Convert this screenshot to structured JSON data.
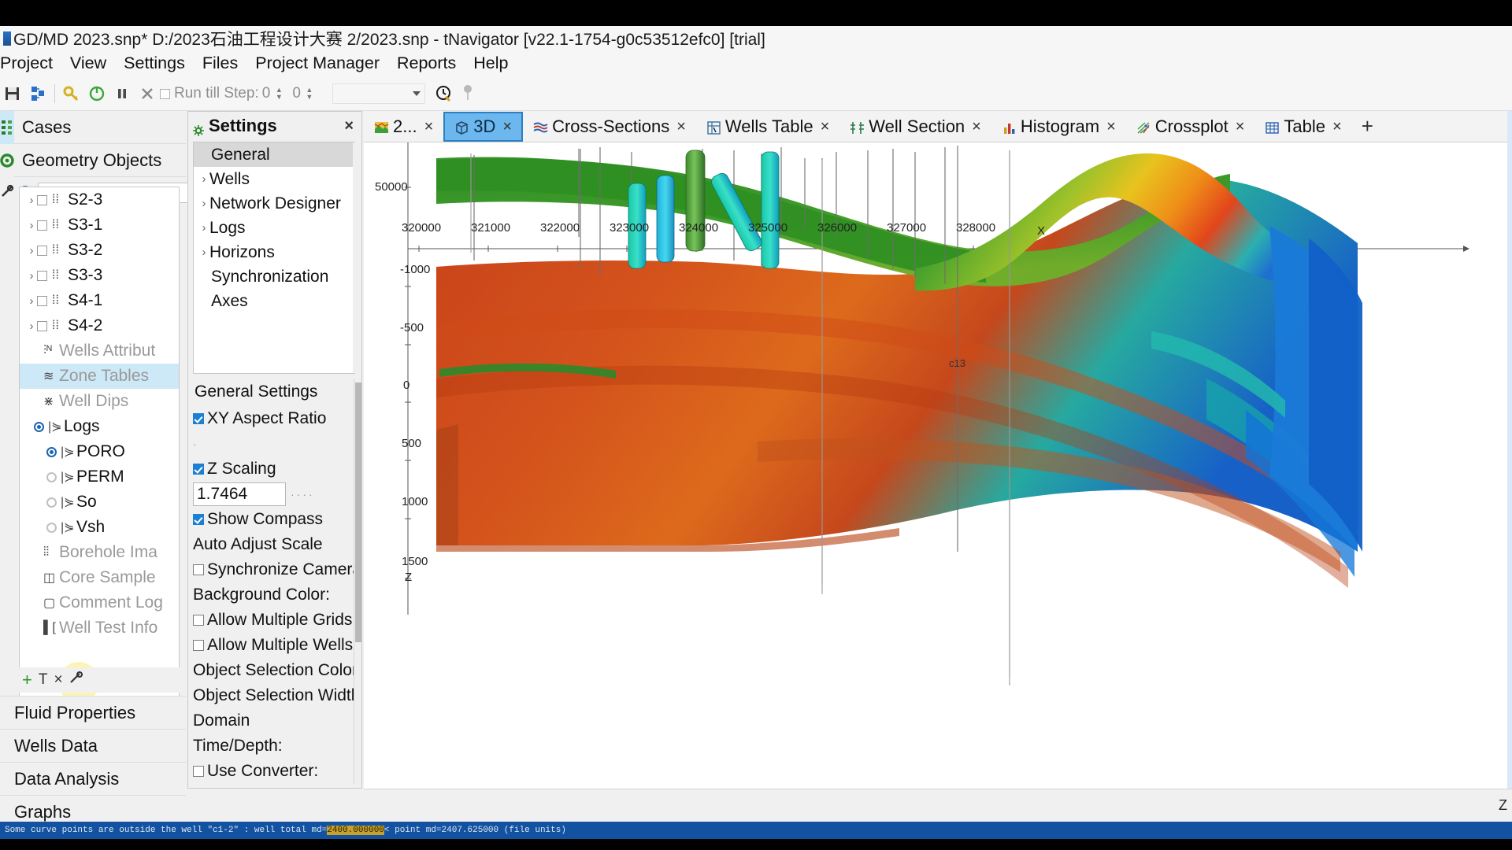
{
  "window": {
    "title": "GD/MD 2023.snp* D:/2023石油工程设计大赛 2/2023.snp - tNavigator [v22.1-1754-g0c53512efc0] [trial]"
  },
  "menubar": {
    "items": [
      {
        "label": "Project"
      },
      {
        "label": "View"
      },
      {
        "label": "Settings"
      },
      {
        "label": "Files"
      },
      {
        "label": "Project Manager"
      },
      {
        "label": "Reports"
      },
      {
        "label": "Help"
      }
    ]
  },
  "toolbar": {
    "run_till_step_label": "Run till Step:",
    "step_value": "0",
    "step_value2": "0",
    "combo_value": ""
  },
  "left_panel": {
    "header_cases": "Cases",
    "header_geometry": "Geometry Objects",
    "search_value": "",
    "search_placeholder": "",
    "tree": [
      {
        "label": "S2-3",
        "kind": "checkbox",
        "expandable": true,
        "dim": false,
        "selected": false
      },
      {
        "label": "S3-1",
        "kind": "checkbox",
        "expandable": true,
        "dim": false,
        "selected": false
      },
      {
        "label": "S3-2",
        "kind": "checkbox",
        "expandable": true,
        "dim": false,
        "selected": false
      },
      {
        "label": "S3-3",
        "kind": "checkbox",
        "expandable": true,
        "dim": false,
        "selected": false
      },
      {
        "label": "S4-1",
        "kind": "checkbox",
        "expandable": true,
        "dim": false,
        "selected": false
      },
      {
        "label": "S4-2",
        "kind": "checkbox",
        "expandable": true,
        "dim": false,
        "selected": false
      },
      {
        "label": "Wells Attribut",
        "kind": "icon",
        "expandable": false,
        "dim": true,
        "selected": false
      },
      {
        "label": "Zone Tables",
        "kind": "icon",
        "expandable": false,
        "dim": true,
        "selected": true
      },
      {
        "label": "Well Dips",
        "kind": "icon",
        "expandable": false,
        "dim": true,
        "selected": false
      },
      {
        "label": "Logs",
        "kind": "radio-on",
        "expandable": false,
        "dim": false,
        "selected": false
      },
      {
        "label": "PORO",
        "kind": "radio-on",
        "expandable": false,
        "dim": false,
        "selected": false,
        "indent": 1
      },
      {
        "label": "PERM",
        "kind": "radio-off",
        "expandable": false,
        "dim": false,
        "selected": false,
        "indent": 1
      },
      {
        "label": "So",
        "kind": "radio-off",
        "expandable": false,
        "dim": false,
        "selected": false,
        "indent": 1
      },
      {
        "label": "Vsh",
        "kind": "radio-off",
        "expandable": false,
        "dim": false,
        "selected": false,
        "indent": 1
      },
      {
        "label": "Borehole Ima",
        "kind": "icon",
        "expandable": false,
        "dim": true,
        "selected": false
      },
      {
        "label": "Core Sample",
        "kind": "icon",
        "expandable": false,
        "dim": true,
        "selected": false
      },
      {
        "label": "Comment Log",
        "kind": "icon",
        "expandable": false,
        "dim": true,
        "selected": false
      },
      {
        "label": "Well Test Info",
        "kind": "icon",
        "expandable": false,
        "dim": true,
        "selected": false
      }
    ],
    "action_row": {
      "add": "+",
      "text": "T",
      "close": "×"
    },
    "nav_items": [
      {
        "label": "Fluid Properties"
      },
      {
        "label": "Wells Data"
      },
      {
        "label": "Data Analysis"
      },
      {
        "label": "Graphs"
      }
    ]
  },
  "settings": {
    "title": "Settings",
    "close": "×",
    "tree": [
      {
        "label": "General",
        "selected": true,
        "expandable": false
      },
      {
        "label": "Wells",
        "selected": false,
        "expandable": true
      },
      {
        "label": "Network Designer",
        "selected": false,
        "expandable": true
      },
      {
        "label": "Logs",
        "selected": false,
        "expandable": true
      },
      {
        "label": "Horizons",
        "selected": false,
        "expandable": true
      },
      {
        "label": "Synchronization",
        "selected": false,
        "expandable": false
      },
      {
        "label": "Axes",
        "selected": false,
        "expandable": false
      }
    ],
    "body_title": "General Settings",
    "options": [
      {
        "label": "XY Aspect Ratio",
        "type": "checkbox",
        "checked": true
      },
      {
        "label": "",
        "type": "slider",
        "checked": false
      },
      {
        "label": "Z Scaling",
        "type": "checkbox",
        "checked": true
      },
      {
        "label": "1.7464",
        "type": "input",
        "checked": false
      },
      {
        "label": "Show Compass",
        "type": "checkbox",
        "checked": true
      },
      {
        "label": "Auto Adjust Scale",
        "type": "text",
        "checked": false
      },
      {
        "label": "Synchronize Cameras",
        "type": "checkbox",
        "checked": false
      },
      {
        "label": "Background Color:",
        "type": "text",
        "checked": false
      },
      {
        "label": "Allow Multiple Grids",
        "type": "checkbox",
        "checked": false
      },
      {
        "label": "Allow Multiple Wells",
        "type": "checkbox",
        "checked": false
      },
      {
        "label": "Object Selection Color",
        "type": "text",
        "checked": false
      },
      {
        "label": "Object Selection Width",
        "type": "text",
        "checked": false
      },
      {
        "label": "Domain",
        "type": "text",
        "checked": false
      },
      {
        "label": "Time/Depth:",
        "type": "text",
        "checked": false
      },
      {
        "label": "Use Converter:",
        "type": "checkbox",
        "checked": false
      }
    ]
  },
  "tabs": {
    "items": [
      {
        "label": "2...",
        "icon": "map-icon",
        "active": false
      },
      {
        "label": "3D",
        "icon": "cube-icon",
        "active": true
      },
      {
        "label": "Cross-Sections",
        "icon": "cross-section-icon",
        "active": false
      },
      {
        "label": "Wells Table",
        "icon": "wells-table-icon",
        "active": false
      },
      {
        "label": "Well Section",
        "icon": "well-section-icon",
        "active": false
      },
      {
        "label": "Histogram",
        "icon": "histogram-icon",
        "active": false
      },
      {
        "label": "Crossplot",
        "icon": "crossplot-icon",
        "active": false
      },
      {
        "label": "Table",
        "icon": "table-icon",
        "active": false
      }
    ],
    "add_label": "+",
    "close_glyph": "×"
  },
  "viewport": {
    "x_axis_label": "X",
    "z_axis_label": "Z",
    "x_ticks": [
      "320000",
      "321000",
      "322000",
      "323000",
      "324000",
      "325000",
      "326000",
      "327000",
      "328000"
    ],
    "z_ticks": [
      "50000",
      "-1000",
      "-500",
      "0",
      "500",
      "1000",
      "1500"
    ],
    "well_annotation": "c13",
    "bottom_right_label": "Z"
  },
  "status": {
    "message_prefix": "Some curve points are outside the well \"c1-2\" : well total md=",
    "message_hl": "2400.000000",
    "message_suffix": " < point md=2407.625000 (file units)"
  },
  "colors": {
    "accent_blue": "#6cb7ee",
    "accent_border": "#2d7fc4",
    "selection_blue": "#cde8f7",
    "status_bar": "#1352a0",
    "status_highlight": "#c8a22a",
    "panel_bg": "#f0f0f0"
  }
}
